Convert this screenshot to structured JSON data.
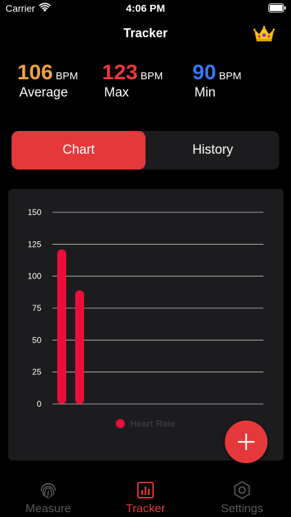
{
  "status_bar": {
    "carrier": "Carrier",
    "time": "4:06 PM"
  },
  "header": {
    "title": "Tracker",
    "premium_icon": "crown-icon"
  },
  "stats": {
    "average": {
      "value": "106",
      "unit": "BPM",
      "label": "Average",
      "color": "#f2a33a"
    },
    "max": {
      "value": "123",
      "unit": "BPM",
      "label": "Max",
      "color": "#ef3838"
    },
    "min": {
      "value": "90",
      "unit": "BPM",
      "label": "Min",
      "color": "#3478f6"
    }
  },
  "segments": {
    "chart_label": "Chart",
    "history_label": "History",
    "selected": "Chart"
  },
  "chart_data": {
    "type": "bar",
    "categories": [
      "",
      ""
    ],
    "series": [
      {
        "name": "Heart Rate",
        "values": [
          121,
          89
        ],
        "color": "#e8103a"
      }
    ],
    "ylim": [
      0,
      150
    ],
    "yticks": [
      "150",
      "125",
      "100",
      "75",
      "50",
      "25",
      "0"
    ],
    "grid": true,
    "legend": "bottom-center"
  },
  "tabs": [
    {
      "label": "Measure",
      "icon": "fingerprint-icon",
      "active": false
    },
    {
      "label": "Tracker",
      "icon": "bar-chart-icon",
      "active": true
    },
    {
      "label": "Settings",
      "icon": "gear-icon",
      "active": false
    }
  ],
  "colors": {
    "accent": "#e5383b",
    "inactive_tab": "#5a5a5e",
    "card": "#1c1c1e"
  }
}
